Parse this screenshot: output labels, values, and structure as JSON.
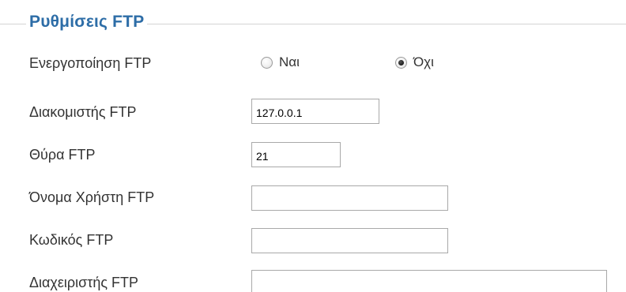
{
  "section": {
    "legend": "Ρυθμίσεις FTP"
  },
  "fields": {
    "enable": {
      "label": "Ενεργοποίηση FTP",
      "options": [
        {
          "label": "Ναι",
          "selected": false
        },
        {
          "label": "Όχι",
          "selected": true
        }
      ]
    },
    "server": {
      "label": "Διακομιστής FTP",
      "value": "127.0.0.1",
      "placeholder": ""
    },
    "port": {
      "label": "Θύρα FTP",
      "value": "21",
      "placeholder": ""
    },
    "username": {
      "label": "Όνομα Χρήστη FTP",
      "value": "",
      "placeholder": ""
    },
    "password": {
      "label": "Κωδικός FTP",
      "value": "",
      "placeholder": ""
    },
    "admin": {
      "label": "Διαχειριστής FTP",
      "value": "",
      "placeholder": ""
    }
  },
  "colors": {
    "legend": "#2d6da7",
    "label_text": "#333333",
    "input_border": "#a9a9a9",
    "fieldset_rule": "#d4d4d4"
  },
  "icons": {
    "radio_unchecked": "radio-unchecked-icon",
    "radio_checked": "radio-checked-icon"
  }
}
